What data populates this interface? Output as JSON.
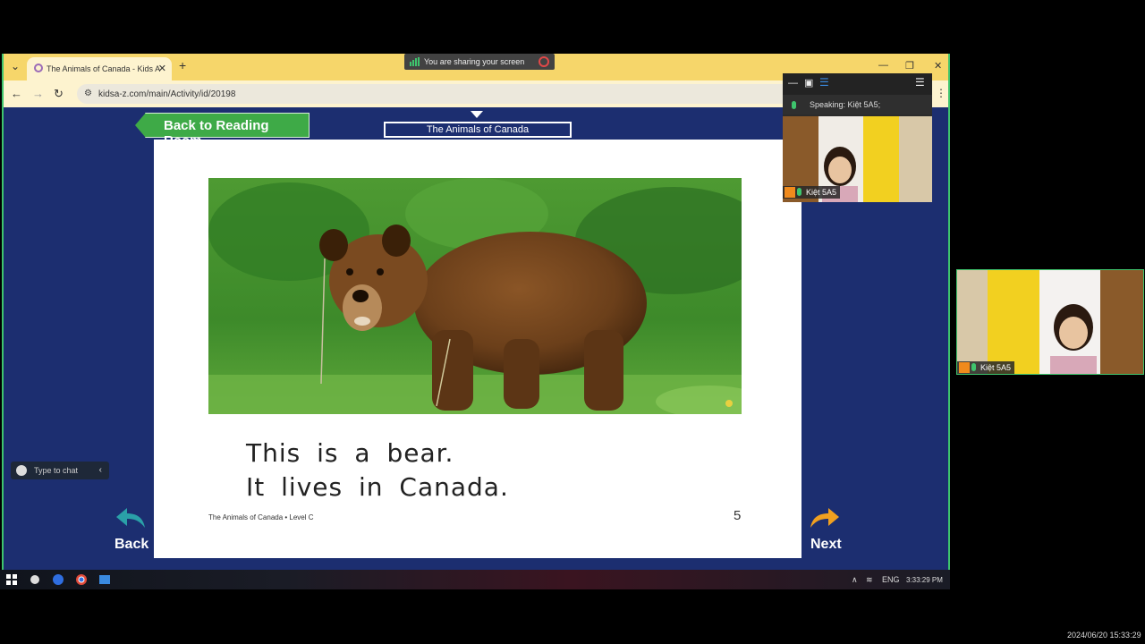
{
  "browser": {
    "tab_title": "The Animals of Canada - Kids A",
    "url": "kidsa-z.com/main/Activity/id/20198",
    "sharing_text": "You are sharing your screen"
  },
  "reader": {
    "back_to_room": "Back to Reading Room",
    "book_title": "The Animals of Canada",
    "page_line1": "This is a bear.",
    "page_line2": "It lives in Canada.",
    "footer": "The Animals of Canada • Level C",
    "page_number": "5",
    "back_label": "Back",
    "next_label": "Next"
  },
  "chat": {
    "placeholder": "Type to chat"
  },
  "meeting": {
    "speaking_label": "Speaking:",
    "speaking_name": "Kiệt 5A5;",
    "participant_name_small": "Kiệt 5A5",
    "participant_name_large": "Kiệt 5A5"
  },
  "taskbar": {
    "language": "ENG",
    "time": "3:33:29 PM"
  },
  "recording_timestamp": "2024/06/20 15:33:29",
  "colors": {
    "browser_frame": "#f6d66a",
    "page_background": "#1c2e70",
    "reading_room_button": "#3eaa47",
    "nav_back_arrow": "#2aa0a8",
    "nav_next_arrow": "#f0a020"
  }
}
